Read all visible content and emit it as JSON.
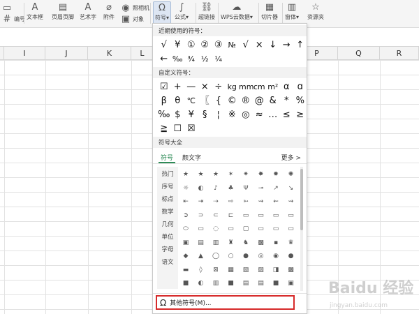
{
  "ribbon": {
    "items": [
      {
        "label": "编号",
        "icon": "numbering-icon",
        "glyph": "#"
      },
      {
        "label": "文本框",
        "icon": "textbox-icon",
        "glyph": "A"
      },
      {
        "label": "页眉页脚",
        "icon": "header-footer-icon",
        "glyph": "▤"
      },
      {
        "label": "艺术字",
        "icon": "wordart-icon",
        "glyph": "A"
      },
      {
        "label": "附件",
        "icon": "attachment-icon",
        "glyph": "⌀"
      },
      {
        "label": "照相机",
        "icon": "camera-icon",
        "glyph": "◉"
      },
      {
        "label": "对象",
        "icon": "object-icon",
        "glyph": "▣"
      },
      {
        "label": "符号",
        "icon": "omega-icon",
        "glyph": "Ω"
      },
      {
        "label": "公式",
        "icon": "formula-icon",
        "glyph": "∫"
      },
      {
        "label": "超链接",
        "icon": "link-icon",
        "glyph": "⛓"
      },
      {
        "label": "WPS云数据",
        "icon": "cloud-data-icon",
        "glyph": "☁"
      },
      {
        "label": "切片器",
        "icon": "slicer-icon",
        "glyph": "▦"
      },
      {
        "label": "窗体",
        "icon": "form-icon",
        "glyph": "▥"
      },
      {
        "label": "资源夹",
        "icon": "resource-icon",
        "glyph": "☆"
      }
    ]
  },
  "columns": [
    "I",
    "J",
    "K",
    "L",
    "P",
    "Q",
    "R"
  ],
  "panel": {
    "recent_title": "近期使用的符号：",
    "recent_row1": [
      "√",
      "¥",
      "①",
      "②",
      "③",
      "№",
      "√",
      "×",
      "↓",
      "→",
      "↑"
    ],
    "recent_row2": [
      "←",
      "‰",
      "¾",
      "½",
      "¼"
    ],
    "custom_title": "自定义符号：",
    "custom_row1": [
      "☑",
      "+",
      "—",
      "×",
      "÷",
      "kg",
      "mm",
      "cm",
      "m²",
      "α",
      "ɑ",
      "α"
    ],
    "custom_row2": [
      "β",
      "θ",
      "℃",
      "〖",
      "{",
      "©",
      "®",
      "@",
      "&",
      "*",
      "%"
    ],
    "custom_row3": [
      "‰",
      "$",
      "¥",
      "§",
      "¦",
      "※",
      "◎",
      "≈",
      "…",
      "≤",
      "≥",
      "≦"
    ],
    "custom_row4": [
      "≧",
      "☐",
      "☒"
    ],
    "all_title": "符号大全",
    "tabs": [
      "符号",
      "颜文字"
    ],
    "more": "更多 >",
    "categories": [
      "热门",
      "序号",
      "标点",
      "数学",
      "几何",
      "单位",
      "字母",
      "语文"
    ],
    "icon_rows": [
      [
        "★",
        "★",
        "★",
        "✶",
        "✷",
        "✸",
        "✹",
        "✺"
      ],
      [
        "☼",
        "◐",
        "♪",
        "♣",
        "Ψ",
        "⊸",
        "↗",
        "↘"
      ],
      [
        "⇤",
        "⇥",
        "⇢",
        "⇨",
        "➳",
        "⇝",
        "⇜",
        "⇝"
      ],
      [
        "➲",
        "⊃",
        "⊂",
        "⊏",
        "▭",
        "▭",
        "▭",
        "▭"
      ],
      [
        "⬭",
        "▭",
        "◌",
        "▭",
        "▢",
        "▭",
        "▭",
        "▭"
      ],
      [
        "▣",
        "▤",
        "▥",
        "♜",
        "♞",
        "▩",
        "▪",
        "♛"
      ],
      [
        "◆",
        "▲",
        "◯",
        "○",
        "●",
        "◎",
        "◉",
        "●"
      ],
      [
        "▬",
        "◊",
        "⊠",
        "▦",
        "▧",
        "▨",
        "◨",
        "▩"
      ],
      [
        "■",
        "◐",
        "▥",
        "■",
        "▤",
        "▤",
        "■",
        "▣"
      ],
      [
        "∗",
        "◦",
        "→",
        "≡",
        "⋯",
        "⋅",
        "⋅",
        "⋄"
      ],
      [
        "⊹",
        "≷",
        "∼",
        "≈",
        "∽",
        "⋯",
        "⋅",
        "⋄"
      ]
    ],
    "other_symbols": "其他符号(M)..."
  },
  "watermark": {
    "text": "Baidu 经验",
    "url": "jingyan.baidu.com"
  }
}
